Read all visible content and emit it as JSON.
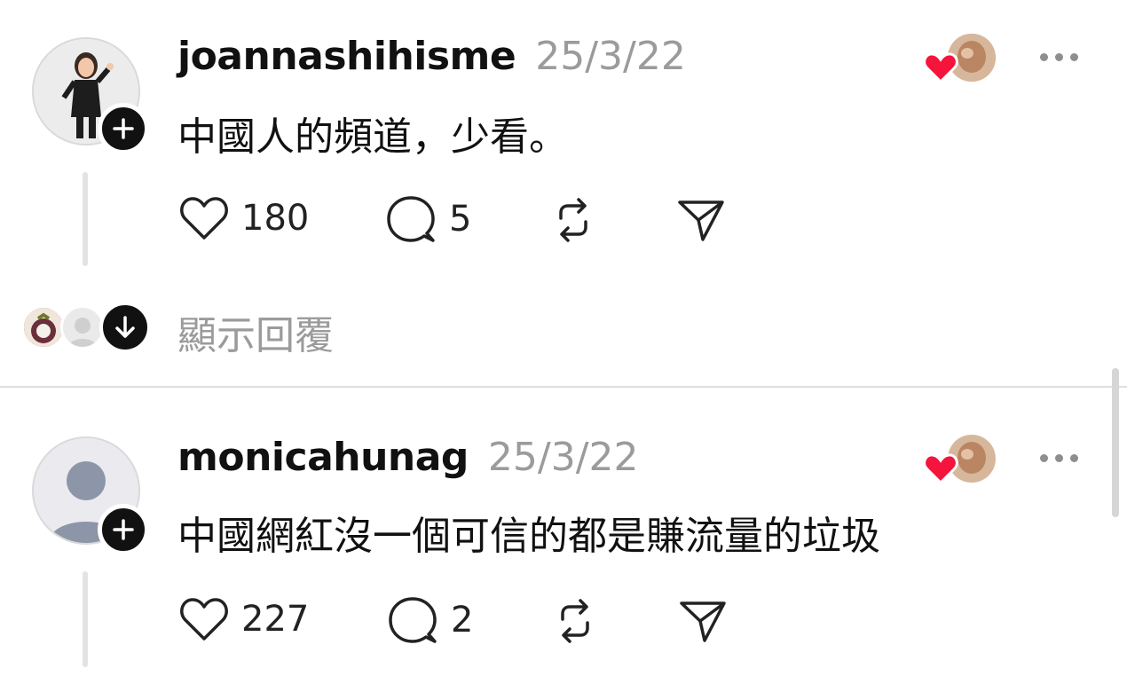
{
  "posts": [
    {
      "username": "joannashihisme",
      "date": "25/3/22",
      "text": "中國人的頻道，少看。",
      "likes": "180",
      "comments": "5"
    },
    {
      "username": "monicahunag",
      "date": "25/3/22",
      "text": "中國網紅沒一個可信的都是賺流量的垃圾",
      "likes": "227",
      "comments": "2"
    }
  ],
  "show_replies": "顯示回覆",
  "colors": {
    "heart": "#f5143c",
    "muted": "#9b9b9b",
    "badge": "#111111"
  }
}
